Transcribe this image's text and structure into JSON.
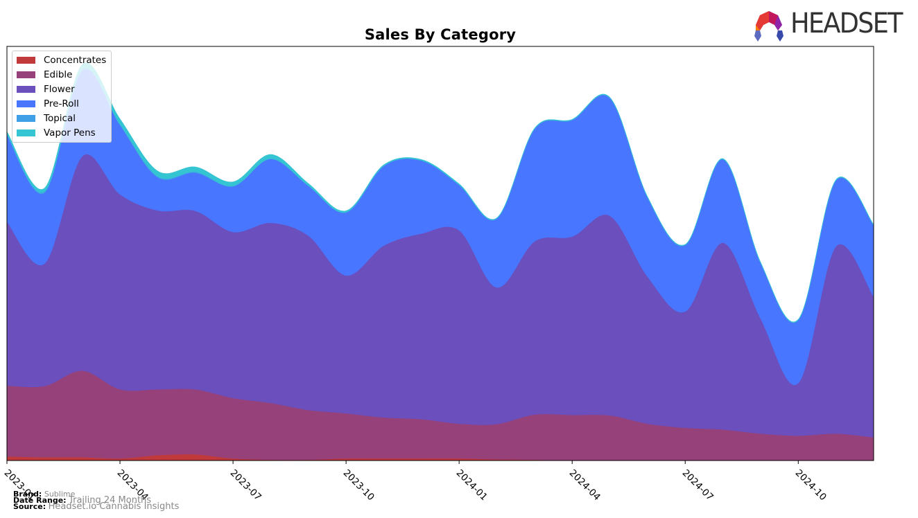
{
  "header": {
    "title": "Sales By Category",
    "logo_text": "HEADSET"
  },
  "footer": {
    "brand_label": "Brand:",
    "brand_value": "Sublime",
    "date_range_label": "Date Range:",
    "date_range_value": "Trailing 24 Months",
    "source_label": "Source:",
    "source_value": "Headset.io Cannabis Insights"
  },
  "chart_data": {
    "type": "area",
    "stacked": true,
    "title": "Sales By Category",
    "xlabel": "",
    "ylabel": "",
    "y_ticks_shown": false,
    "grid": false,
    "legend_position": "top-left",
    "x_tick_labels": [
      "2023-01",
      "2023-04",
      "2023-07",
      "2023-10",
      "2024-01",
      "2024-04",
      "2024-07",
      "2024-10"
    ],
    "x": [
      "2023-01",
      "2023-02",
      "2023-03",
      "2023-04",
      "2023-05",
      "2023-06",
      "2023-07",
      "2023-08",
      "2023-09",
      "2023-10",
      "2023-11",
      "2023-12",
      "2024-01",
      "2024-02",
      "2024-03",
      "2024-04",
      "2024-05",
      "2024-06",
      "2024-07",
      "2024-08",
      "2024-09",
      "2024-10",
      "2024-11",
      "2024-12"
    ],
    "ylim": [
      0,
      100
    ],
    "series": [
      {
        "name": "Concentrates",
        "color": "#c0393b",
        "values": [
          1.0,
          0.8,
          0.8,
          0.5,
          1.3,
          1.5,
          0.5,
          0.2,
          0.2,
          0.5,
          0.5,
          0.5,
          0.5,
          0.3,
          0.2,
          0.0,
          0.0,
          0.0,
          0.0,
          0.0,
          0.0,
          0.0,
          0.0,
          0.0
        ]
      },
      {
        "name": "Edible",
        "color": "#96417a",
        "values": [
          17.1,
          17.2,
          20.9,
          16.7,
          15.9,
          15.7,
          14.6,
          13.7,
          12.0,
          10.9,
          9.9,
          9.5,
          8.4,
          8.5,
          10.9,
          11.0,
          10.9,
          8.9,
          7.9,
          7.5,
          6.5,
          6.0,
          6.5,
          5.6
        ]
      },
      {
        "name": "Flower",
        "color": "#6a4fbd",
        "values": [
          39.6,
          29.6,
          51.8,
          47.1,
          43.2,
          43.1,
          40.1,
          43.5,
          42.1,
          33.3,
          41.5,
          44.8,
          46.7,
          33.0,
          41.8,
          43.1,
          48.2,
          35.5,
          28.1,
          45.1,
          27.8,
          12.7,
          45.2,
          34.0
        ]
      },
      {
        "name": "Pre-Roll",
        "color": "#4876ff",
        "values": [
          20.9,
          17.1,
          20.6,
          16.7,
          8.0,
          9.2,
          11.0,
          15.4,
          12.0,
          15.2,
          19.2,
          17.6,
          10.9,
          16.6,
          27.1,
          28.1,
          28.4,
          19.1,
          16.0,
          20.1,
          13.4,
          15.2,
          15.9,
          17.2
        ]
      },
      {
        "name": "Topical",
        "color": "#3fa0e8",
        "values": [
          0.3,
          0.3,
          0.3,
          0.2,
          0.2,
          0.2,
          0.1,
          0.1,
          0.1,
          0.1,
          0.1,
          0.1,
          0.1,
          0.1,
          0.1,
          0.1,
          0.1,
          0.1,
          0.1,
          0.1,
          0.1,
          0.1,
          0.1,
          0.1
        ]
      },
      {
        "name": "Vapor Pens",
        "color": "#35c4d1",
        "values": [
          0.5,
          0.8,
          1.2,
          1.3,
          1.3,
          1.2,
          1.0,
          1.0,
          0.5,
          0.3,
          0.2,
          0.2,
          0.2,
          0.1,
          0.1,
          0.1,
          0.1,
          0.1,
          0.1,
          0.1,
          0.1,
          0.1,
          0.1,
          0.1
        ]
      }
    ]
  }
}
